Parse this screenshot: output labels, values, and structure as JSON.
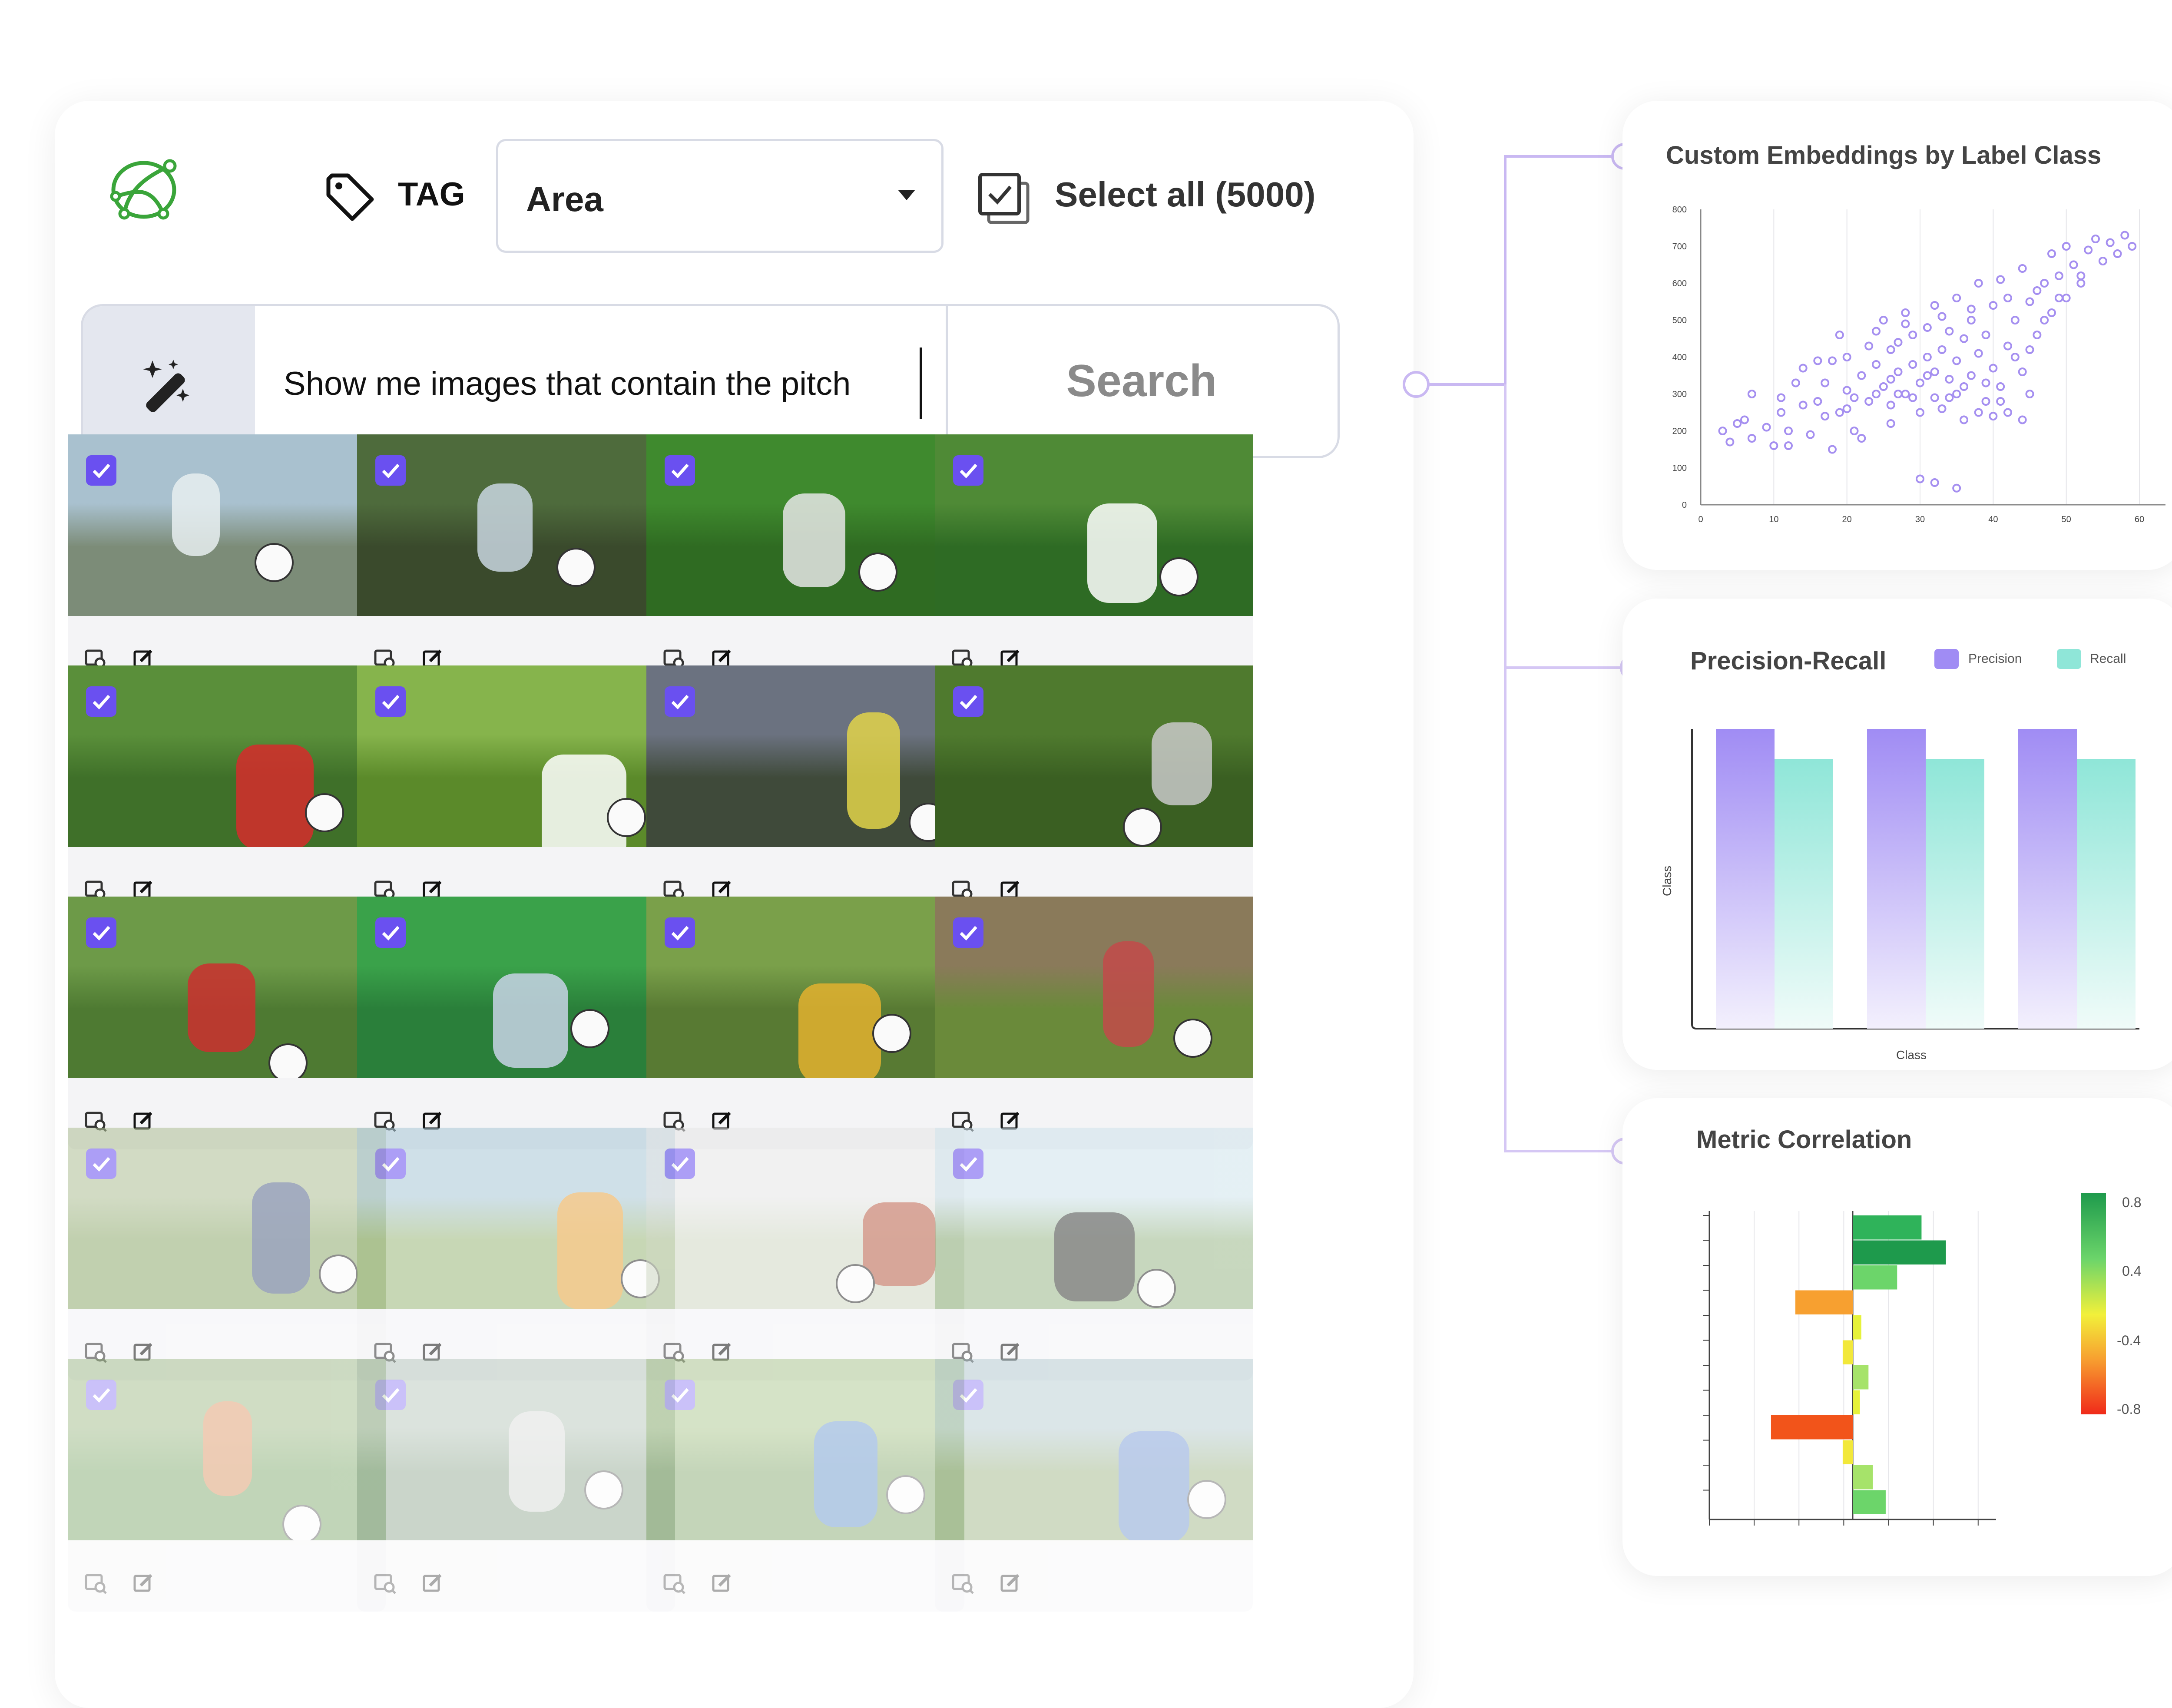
{
  "toolbar": {
    "tag_label": "TAG",
    "dropdown_value": "Area",
    "select_all_label": "Select all (5000)"
  },
  "search": {
    "query": "Show me images that contain the pitch",
    "button_label": "Search"
  },
  "gallery": {
    "rows_visible": 5,
    "columns": 4,
    "all_selected": true
  },
  "widgets": {
    "embeddings": {
      "title": "Custom Embeddings by Label Class"
    },
    "pr": {
      "title": "Precision-Recall",
      "legend_precision": "Precision",
      "legend_recall": "Recall",
      "xlabel": "Class",
      "ylabel": "Class"
    },
    "corr": {
      "title": "Metric Correlation",
      "cb_0": "0.8",
      "cb_1": "0.4",
      "cb_2": "-0.4",
      "cb_3": "-0.8"
    }
  },
  "colors": {
    "accent": "#6a50f0",
    "precision": "#a08cf4",
    "recall": "#8fe6d8",
    "scatter": "#a58ff0",
    "logo_green": "#3aa53a"
  },
  "chart_data": [
    {
      "type": "scatter",
      "title": "Custom Embeddings by Label Class",
      "xlim": [
        0,
        60
      ],
      "ylim": [
        0,
        800
      ],
      "xticks": [
        0,
        10,
        20,
        30,
        40,
        50,
        60
      ],
      "yticks": [
        0,
        100,
        200,
        300,
        400,
        500,
        600,
        700,
        800
      ],
      "grid": "vertical",
      "points": [
        [
          3,
          200
        ],
        [
          4,
          170
        ],
        [
          5,
          220
        ],
        [
          6,
          230
        ],
        [
          7,
          180
        ],
        [
          7,
          300
        ],
        [
          9,
          210
        ],
        [
          10,
          160
        ],
        [
          11,
          250
        ],
        [
          11,
          290
        ],
        [
          12,
          200
        ],
        [
          13,
          330
        ],
        [
          14,
          370
        ],
        [
          15,
          190
        ],
        [
          16,
          280
        ],
        [
          17,
          330
        ],
        [
          18,
          390
        ],
        [
          19,
          250
        ],
        [
          20,
          310
        ],
        [
          20,
          400
        ],
        [
          21,
          200
        ],
        [
          22,
          350
        ],
        [
          23,
          280
        ],
        [
          23,
          430
        ],
        [
          24,
          380
        ],
        [
          25,
          320
        ],
        [
          25,
          500
        ],
        [
          26,
          270
        ],
        [
          26,
          420
        ],
        [
          27,
          360
        ],
        [
          27,
          440
        ],
        [
          28,
          300
        ],
        [
          28,
          520
        ],
        [
          29,
          380
        ],
        [
          29,
          460
        ],
        [
          30,
          250
        ],
        [
          30,
          330
        ],
        [
          31,
          400
        ],
        [
          31,
          480
        ],
        [
          32,
          290
        ],
        [
          32,
          360
        ],
        [
          32,
          540
        ],
        [
          33,
          420
        ],
        [
          33,
          260
        ],
        [
          34,
          340
        ],
        [
          34,
          470
        ],
        [
          35,
          300
        ],
        [
          35,
          390
        ],
        [
          35,
          560
        ],
        [
          36,
          450
        ],
        [
          36,
          230
        ],
        [
          37,
          350
        ],
        [
          37,
          500
        ],
        [
          38,
          410
        ],
        [
          38,
          600
        ],
        [
          39,
          280
        ],
        [
          39,
          460
        ],
        [
          40,
          370
        ],
        [
          40,
          540
        ],
        [
          41,
          320
        ],
        [
          41,
          610
        ],
        [
          42,
          430
        ],
        [
          42,
          250
        ],
        [
          43,
          500
        ],
        [
          44,
          360
        ],
        [
          44,
          640
        ],
        [
          45,
          550
        ],
        [
          45,
          300
        ],
        [
          46,
          460
        ],
        [
          47,
          600
        ],
        [
          48,
          520
        ],
        [
          48,
          680
        ],
        [
          49,
          620
        ],
        [
          50,
          560
        ],
        [
          50,
          700
        ],
        [
          51,
          650
        ],
        [
          52,
          600
        ],
        [
          53,
          690
        ],
        [
          54,
          720
        ],
        [
          55,
          660
        ],
        [
          56,
          710
        ],
        [
          57,
          680
        ],
        [
          58,
          730
        ],
        [
          59,
          700
        ],
        [
          30,
          70
        ],
        [
          32,
          60
        ],
        [
          35,
          45
        ],
        [
          12,
          160
        ],
        [
          18,
          150
        ],
        [
          22,
          180
        ],
        [
          26,
          220
        ],
        [
          40,
          240
        ],
        [
          44,
          230
        ],
        [
          16,
          390
        ],
        [
          19,
          460
        ],
        [
          24,
          470
        ],
        [
          28,
          490
        ],
        [
          33,
          510
        ],
        [
          37,
          530
        ],
        [
          42,
          560
        ],
        [
          46,
          580
        ],
        [
          52,
          620
        ],
        [
          27,
          300
        ],
        [
          31,
          350
        ],
        [
          36,
          320
        ],
        [
          39,
          330
        ],
        [
          41,
          280
        ],
        [
          43,
          400
        ],
        [
          45,
          420
        ],
        [
          47,
          500
        ],
        [
          49,
          560
        ],
        [
          21,
          290
        ],
        [
          24,
          300
        ],
        [
          26,
          340
        ],
        [
          29,
          290
        ],
        [
          34,
          290
        ],
        [
          38,
          250
        ],
        [
          14,
          270
        ],
        [
          17,
          240
        ],
        [
          20,
          260
        ]
      ]
    },
    {
      "type": "bar",
      "title": "Precision-Recall",
      "categories": [
        "",
        "",
        ""
      ],
      "series": [
        {
          "name": "Precision",
          "values": [
            1.0,
            1.0,
            1.0
          ]
        },
        {
          "name": "Recall",
          "values": [
            0.9,
            0.9,
            0.9
          ]
        }
      ],
      "xlabel": "Class",
      "ylabel": "Class",
      "ylim": [
        0,
        1
      ],
      "legend": "top-right"
    },
    {
      "type": "bar",
      "title": "Metric Correlation",
      "orientation": "horizontal",
      "values": [
        0.48,
        0.65,
        0.31,
        -0.4,
        0.06,
        -0.07,
        0.11,
        0.05,
        -0.57,
        -0.07,
        0.14,
        0.23
      ],
      "xlim": [
        -1,
        1
      ],
      "colorbar_ticks": [
        "0.8",
        "0.4",
        "-0.4",
        "-0.8"
      ]
    }
  ]
}
